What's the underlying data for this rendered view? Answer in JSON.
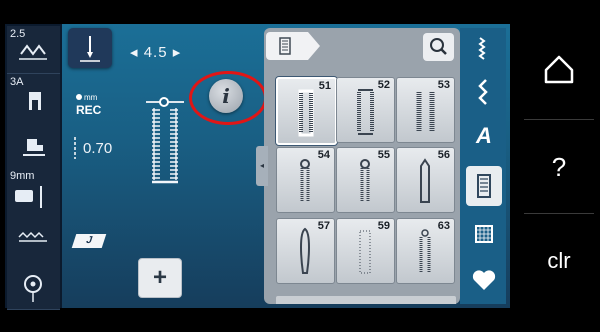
{
  "left_tools": [
    {
      "label": "2.5",
      "icon": "stitch-width-icon"
    },
    {
      "label": "3A",
      "icon": "presser-foot-icon"
    },
    {
      "label": "",
      "icon": "presser-pressure-icon"
    },
    {
      "label": "9mm",
      "icon": "needle-plate-icon"
    },
    {
      "label": "",
      "icon": "feed-dog-icon"
    },
    {
      "label": "",
      "icon": "bobbin-icon"
    }
  ],
  "stitch_width": {
    "value": "4.5",
    "left_arrow": "◂",
    "right_arrow": "▸"
  },
  "record": {
    "unit": "mm",
    "label": "REC"
  },
  "stitch_length": {
    "value": "0.70"
  },
  "info_button": {
    "label": "i"
  },
  "presser_foot_label": "J",
  "plus_button": {
    "label": "+"
  },
  "collapse_arrow": "◂",
  "stitch_panel": {
    "selected": "51",
    "cells": [
      {
        "num": "51",
        "icon": "buttonhole-dense-icon"
      },
      {
        "num": "52",
        "icon": "buttonhole-wide-icon"
      },
      {
        "num": "53",
        "icon": "buttonhole-double-icon"
      },
      {
        "num": "54",
        "icon": "keyhole-buttonhole-icon"
      },
      {
        "num": "55",
        "icon": "keyhole-buttonhole-2-icon"
      },
      {
        "num": "56",
        "icon": "tapered-buttonhole-icon"
      },
      {
        "num": "57",
        "icon": "rounded-buttonhole-icon"
      },
      {
        "num": "59",
        "icon": "straight-buttonhole-icon"
      },
      {
        "num": "63",
        "icon": "eyelet-buttonhole-icon"
      }
    ]
  },
  "categories": [
    {
      "icon": "straight-stitch-category-icon",
      "active": false
    },
    {
      "icon": "zigzag-category-icon",
      "active": false
    },
    {
      "label": "A",
      "icon": "alphabet-category-icon",
      "active": false
    },
    {
      "icon": "buttonhole-category-icon",
      "active": true
    },
    {
      "icon": "quilt-category-icon",
      "active": false
    },
    {
      "icon": "favorite-heart-icon",
      "active": false
    }
  ],
  "sidebar": {
    "home_icon": "home-icon",
    "help_label": "?",
    "clear_label": "clr"
  },
  "colors": {
    "accent_red": "#e01616",
    "panel_gray": "#9aa3ac",
    "screen_blue": "#1b6f97"
  }
}
